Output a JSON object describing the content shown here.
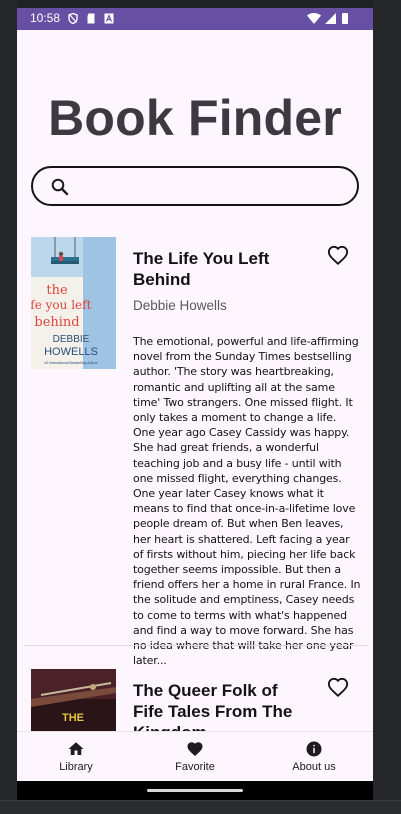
{
  "status_bar": {
    "time": "10:58"
  },
  "app": {
    "title": "Book Finder"
  },
  "search": {
    "value": "",
    "placeholder": ""
  },
  "books": [
    {
      "title": "The Life You Left Behind",
      "author": "Debbie Howells",
      "description": "The emotional, powerful and life-affirming novel from the Sunday Times bestselling author. 'The story was heartbreaking, romantic and uplifting all at the same time' Two strangers. One missed flight. It only takes a moment to change a life. One year ago Casey Cassidy was happy. She had great friends, a wonderful teaching job and a busy life - until with one missed flight, everything changes. One year later Casey knows what it means to find that once-in-a-lifetime love people dream of. But when Ben leaves, her heart is shattered. Left facing a year of firsts without him, piecing her life back together seems impossible. But then a friend offers her a home in rural France. In the solitude and emptiness, Casey needs to come to terms with what's happened and find a way to move forward. She has no idea where that will take her one year later...",
      "cover": {
        "title_line1": "the",
        "title_line2": "life you left",
        "title_line3": "behind",
        "author_line1": "DEBBIE",
        "author_line2": "HOWELLS",
        "tagline": "#1 International Bestselling Author"
      },
      "favorited": false
    },
    {
      "title": "The Queer Folk of Fife Tales From The Kingdom",
      "author": "",
      "description": "",
      "cover": {
        "title_line1": "THE"
      },
      "favorited": false
    }
  ],
  "bottom_nav": [
    {
      "label": "Library",
      "icon": "home-icon"
    },
    {
      "label": "Favorite",
      "icon": "heart-filled-icon"
    },
    {
      "label": "About us",
      "icon": "info-icon"
    }
  ],
  "colors": {
    "status_bar": "#6750a4",
    "background": "#fdf6fe",
    "title_text": "#3c3a40",
    "cover1_sky": "#9ec3e3",
    "cover1_title": "#e0453c"
  }
}
